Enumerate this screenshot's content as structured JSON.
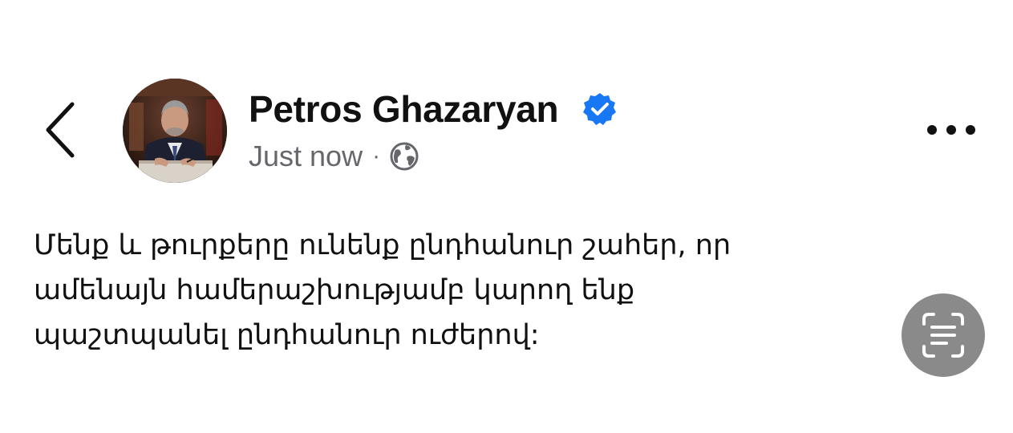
{
  "header": {
    "back_icon": "chevron-left-icon",
    "more_icon": "more-horizontal-icon"
  },
  "author": {
    "name": "Petros Ghazaryan",
    "verified": true,
    "verified_color": "#1877f2",
    "avatar": "profile-photo"
  },
  "meta": {
    "timestamp": "Just now",
    "separator": "·",
    "audience_icon": "globe-icon"
  },
  "post": {
    "lines": [
      "Մենք և թուրքերը ունենք ընդհանուր շահեր, որ",
      "ամենայն համերաշխությամբ կարող ենք",
      "պաշտպանել ընդհանուր ուժերով:"
    ]
  },
  "overlay": {
    "scan_icon": "text-scan-icon"
  },
  "colors": {
    "text": "#111111",
    "secondary_text": "#65676b",
    "scan_button_bg": "#8a8a8a"
  }
}
